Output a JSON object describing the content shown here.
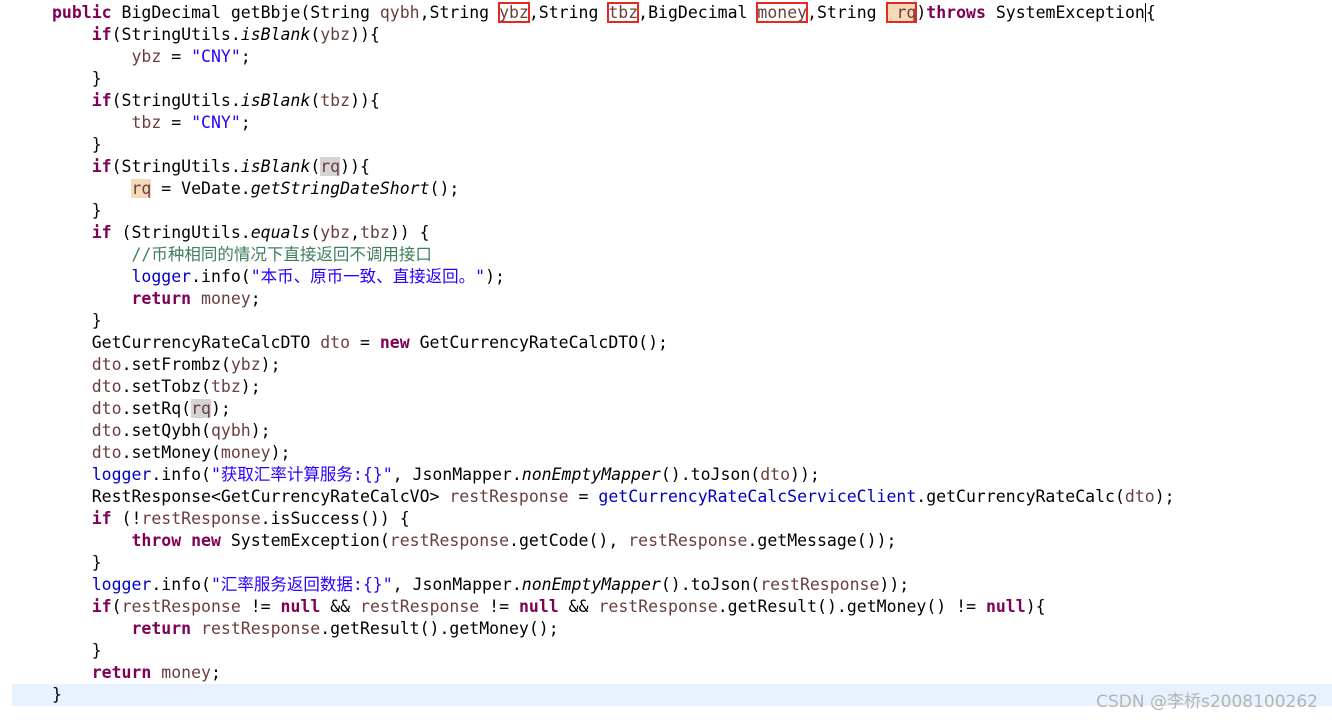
{
  "editor": {
    "indent_unit": "    ",
    "current_line_index": 31,
    "lines": [
      {
        "indent": 0,
        "tokens": [
          {
            "t": "public",
            "c": "kw"
          },
          {
            "t": " BigDecimal getBbje(String ",
            "c": "plain"
          },
          {
            "t": "qybh",
            "c": "var"
          },
          {
            "t": ",String ",
            "c": "plain"
          },
          {
            "t": "ybz",
            "c": "var",
            "box": true
          },
          {
            "t": ",String ",
            "c": "plain"
          },
          {
            "t": "tbz",
            "c": "var",
            "box": true
          },
          {
            "t": ",BigDecimal ",
            "c": "plain"
          },
          {
            "t": "money",
            "c": "var",
            "box": true
          },
          {
            "t": ",String ",
            "c": "plain"
          },
          {
            "t": " rq",
            "c": "var",
            "box": true,
            "hl": "occ"
          },
          {
            "t": ")",
            "c": "plain"
          },
          {
            "t": "throws",
            "c": "kw"
          },
          {
            "t": " SystemException",
            "c": "plain"
          },
          {
            "t": "{",
            "c": "plain",
            "caret": true
          }
        ]
      },
      {
        "indent": 1,
        "tokens": [
          {
            "t": "if",
            "c": "kw"
          },
          {
            "t": "(StringUtils.",
            "c": "plain"
          },
          {
            "t": "isBlank",
            "c": "plain",
            "static": true
          },
          {
            "t": "(",
            "c": "plain"
          },
          {
            "t": "ybz",
            "c": "var"
          },
          {
            "t": ")){",
            "c": "plain"
          }
        ]
      },
      {
        "indent": 2,
        "tokens": [
          {
            "t": "ybz",
            "c": "var"
          },
          {
            "t": " = ",
            "c": "plain"
          },
          {
            "t": "\"CNY\"",
            "c": "str"
          },
          {
            "t": ";",
            "c": "plain"
          }
        ]
      },
      {
        "indent": 1,
        "tokens": [
          {
            "t": "}",
            "c": "plain"
          }
        ]
      },
      {
        "indent": 1,
        "tokens": [
          {
            "t": "if",
            "c": "kw"
          },
          {
            "t": "(StringUtils.",
            "c": "plain"
          },
          {
            "t": "isBlank",
            "c": "plain",
            "static": true
          },
          {
            "t": "(",
            "c": "plain"
          },
          {
            "t": "tbz",
            "c": "var"
          },
          {
            "t": ")){",
            "c": "plain"
          }
        ]
      },
      {
        "indent": 2,
        "tokens": [
          {
            "t": "tbz",
            "c": "var"
          },
          {
            "t": " = ",
            "c": "plain"
          },
          {
            "t": "\"CNY\"",
            "c": "str"
          },
          {
            "t": ";",
            "c": "plain"
          }
        ]
      },
      {
        "indent": 1,
        "tokens": [
          {
            "t": "}",
            "c": "plain"
          }
        ]
      },
      {
        "indent": 1,
        "tokens": [
          {
            "t": "if",
            "c": "kw"
          },
          {
            "t": "(StringUtils.",
            "c": "plain"
          },
          {
            "t": "isBlank",
            "c": "plain",
            "static": true
          },
          {
            "t": "(",
            "c": "plain"
          },
          {
            "t": "rq",
            "c": "var",
            "hl": "grey"
          },
          {
            "t": ")){",
            "c": "plain"
          }
        ]
      },
      {
        "indent": 2,
        "tokens": [
          {
            "t": "rq",
            "c": "var",
            "hl": "occ"
          },
          {
            "t": " = VeDate.",
            "c": "plain"
          },
          {
            "t": "getStringDateShort",
            "c": "plain",
            "static": true
          },
          {
            "t": "();",
            "c": "plain"
          }
        ]
      },
      {
        "indent": 1,
        "tokens": [
          {
            "t": "}",
            "c": "plain"
          }
        ]
      },
      {
        "indent": 1,
        "tokens": [
          {
            "t": "if",
            "c": "kw"
          },
          {
            "t": " (StringUtils.",
            "c": "plain"
          },
          {
            "t": "equals",
            "c": "plain",
            "static": true
          },
          {
            "t": "(",
            "c": "plain"
          },
          {
            "t": "ybz",
            "c": "var"
          },
          {
            "t": ",",
            "c": "plain"
          },
          {
            "t": "tbz",
            "c": "var"
          },
          {
            "t": ")) {",
            "c": "plain"
          }
        ]
      },
      {
        "indent": 2,
        "tokens": [
          {
            "t": "//币种相同的情况下直接返回不调用接口",
            "c": "com"
          }
        ]
      },
      {
        "indent": 2,
        "tokens": [
          {
            "t": "logger",
            "c": "field"
          },
          {
            "t": ".info(",
            "c": "plain"
          },
          {
            "t": "\"本币、原币一致、直接返回。\"",
            "c": "str"
          },
          {
            "t": ");",
            "c": "plain"
          }
        ]
      },
      {
        "indent": 2,
        "tokens": [
          {
            "t": "return",
            "c": "kw"
          },
          {
            "t": " ",
            "c": "plain"
          },
          {
            "t": "money",
            "c": "var"
          },
          {
            "t": ";",
            "c": "plain"
          }
        ]
      },
      {
        "indent": 1,
        "tokens": [
          {
            "t": "}",
            "c": "plain"
          }
        ]
      },
      {
        "indent": 1,
        "tokens": [
          {
            "t": "GetCurrencyRateCalcDTO ",
            "c": "plain"
          },
          {
            "t": "dto",
            "c": "var"
          },
          {
            "t": " = ",
            "c": "plain"
          },
          {
            "t": "new",
            "c": "kw"
          },
          {
            "t": " GetCurrencyRateCalcDTO();",
            "c": "plain"
          }
        ]
      },
      {
        "indent": 1,
        "tokens": [
          {
            "t": "dto",
            "c": "var"
          },
          {
            "t": ".setFrombz(",
            "c": "plain"
          },
          {
            "t": "ybz",
            "c": "var"
          },
          {
            "t": ");",
            "c": "plain"
          }
        ]
      },
      {
        "indent": 1,
        "tokens": [
          {
            "t": "dto",
            "c": "var"
          },
          {
            "t": ".setTobz(",
            "c": "plain"
          },
          {
            "t": "tbz",
            "c": "var"
          },
          {
            "t": ");",
            "c": "plain"
          }
        ]
      },
      {
        "indent": 1,
        "tokens": [
          {
            "t": "dto",
            "c": "var"
          },
          {
            "t": ".setRq(",
            "c": "plain"
          },
          {
            "t": "rq",
            "c": "var",
            "hl": "grey"
          },
          {
            "t": ");",
            "c": "plain"
          }
        ]
      },
      {
        "indent": 1,
        "tokens": [
          {
            "t": "dto",
            "c": "var"
          },
          {
            "t": ".setQybh(",
            "c": "plain"
          },
          {
            "t": "qybh",
            "c": "var"
          },
          {
            "t": ");",
            "c": "plain"
          }
        ]
      },
      {
        "indent": 1,
        "tokens": [
          {
            "t": "dto",
            "c": "var"
          },
          {
            "t": ".setMoney(",
            "c": "plain"
          },
          {
            "t": "money",
            "c": "var"
          },
          {
            "t": ");",
            "c": "plain"
          }
        ]
      },
      {
        "indent": 1,
        "tokens": [
          {
            "t": "logger",
            "c": "field"
          },
          {
            "t": ".info(",
            "c": "plain"
          },
          {
            "t": "\"获取汇率计算服务:{}\"",
            "c": "str"
          },
          {
            "t": ", JsonMapper.",
            "c": "plain"
          },
          {
            "t": "nonEmptyMapper",
            "c": "plain",
            "static": true
          },
          {
            "t": "().toJson(",
            "c": "plain"
          },
          {
            "t": "dto",
            "c": "var"
          },
          {
            "t": "));",
            "c": "plain"
          }
        ]
      },
      {
        "indent": 1,
        "tokens": [
          {
            "t": "RestResponse<GetCurrencyRateCalcVO> ",
            "c": "plain"
          },
          {
            "t": "restResponse",
            "c": "var"
          },
          {
            "t": " = ",
            "c": "plain"
          },
          {
            "t": "getCurrencyRateCalcServiceClient",
            "c": "field"
          },
          {
            "t": ".getCurrencyRateCalc(",
            "c": "plain"
          },
          {
            "t": "dto",
            "c": "var"
          },
          {
            "t": ");",
            "c": "plain"
          }
        ]
      },
      {
        "indent": 1,
        "tokens": [
          {
            "t": "if",
            "c": "kw"
          },
          {
            "t": " (!",
            "c": "plain"
          },
          {
            "t": "restResponse",
            "c": "var"
          },
          {
            "t": ".isSuccess()) {",
            "c": "plain"
          }
        ]
      },
      {
        "indent": 2,
        "tokens": [
          {
            "t": "throw",
            "c": "kw"
          },
          {
            "t": " ",
            "c": "plain"
          },
          {
            "t": "new",
            "c": "kw"
          },
          {
            "t": " SystemException(",
            "c": "plain"
          },
          {
            "t": "restResponse",
            "c": "var"
          },
          {
            "t": ".getCode(), ",
            "c": "plain"
          },
          {
            "t": "restResponse",
            "c": "var"
          },
          {
            "t": ".getMessage());",
            "c": "plain"
          }
        ]
      },
      {
        "indent": 1,
        "tokens": [
          {
            "t": "}",
            "c": "plain"
          }
        ]
      },
      {
        "indent": 1,
        "tokens": [
          {
            "t": "logger",
            "c": "field"
          },
          {
            "t": ".info(",
            "c": "plain"
          },
          {
            "t": "\"汇率服务返回数据:{}\"",
            "c": "str"
          },
          {
            "t": ", JsonMapper.",
            "c": "plain"
          },
          {
            "t": "nonEmptyMapper",
            "c": "plain",
            "static": true
          },
          {
            "t": "().toJson(",
            "c": "plain"
          },
          {
            "t": "restResponse",
            "c": "var"
          },
          {
            "t": "));",
            "c": "plain"
          }
        ]
      },
      {
        "indent": 1,
        "tokens": [
          {
            "t": "if",
            "c": "kw"
          },
          {
            "t": "(",
            "c": "plain"
          },
          {
            "t": "restResponse",
            "c": "var"
          },
          {
            "t": " != ",
            "c": "plain"
          },
          {
            "t": "null",
            "c": "kw"
          },
          {
            "t": " && ",
            "c": "plain"
          },
          {
            "t": "restResponse",
            "c": "var"
          },
          {
            "t": " != ",
            "c": "plain"
          },
          {
            "t": "null",
            "c": "kw"
          },
          {
            "t": " && ",
            "c": "plain"
          },
          {
            "t": "restResponse",
            "c": "var"
          },
          {
            "t": ".getResult().getMoney() != ",
            "c": "plain"
          },
          {
            "t": "null",
            "c": "kw"
          },
          {
            "t": "){",
            "c": "plain"
          }
        ]
      },
      {
        "indent": 2,
        "tokens": [
          {
            "t": "return",
            "c": "kw"
          },
          {
            "t": " ",
            "c": "plain"
          },
          {
            "t": "restResponse",
            "c": "var"
          },
          {
            "t": ".getResult().getMoney();",
            "c": "plain"
          }
        ]
      },
      {
        "indent": 1,
        "tokens": [
          {
            "t": "}",
            "c": "plain"
          }
        ]
      },
      {
        "indent": 1,
        "tokens": [
          {
            "t": "return",
            "c": "kw"
          },
          {
            "t": " ",
            "c": "plain"
          },
          {
            "t": "money",
            "c": "var"
          },
          {
            "t": ";",
            "c": "plain"
          }
        ]
      },
      {
        "indent": 0,
        "tokens": [
          {
            "t": "}",
            "c": "plain"
          }
        ]
      }
    ]
  },
  "watermark": "CSDN @李桥s2008100262",
  "colors": {
    "keyword": "#7f0055",
    "string": "#2a00ff",
    "comment": "#3f7f5f",
    "field": "#0000c0",
    "local_variable": "#6a3e3e",
    "annotation_box": "#e8281e",
    "current_line": "#e8f2fe"
  }
}
